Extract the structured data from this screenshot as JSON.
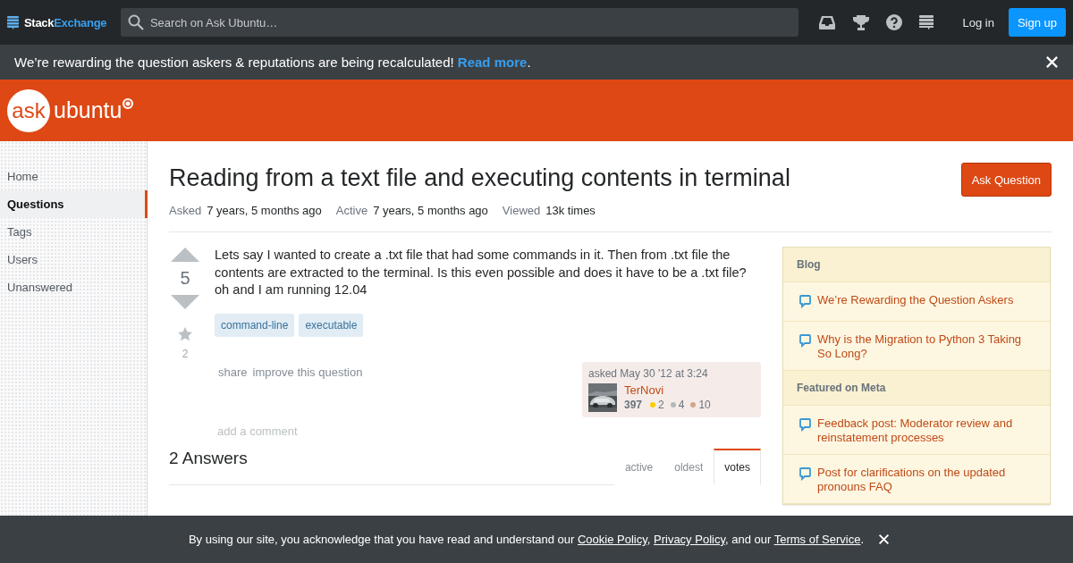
{
  "topbar": {
    "logo": {
      "first": "Stack",
      "second": "Exchange"
    },
    "search": {
      "placeholder": "Search on Ask Ubuntu…"
    },
    "login": "Log in",
    "signup": "Sign up"
  },
  "announcement": {
    "text": "We’re rewarding the question askers & reputations are being recalculated! ",
    "link": "Read more",
    "after": "."
  },
  "site_logo": {
    "bubble": "ask",
    "name": "ubuntu"
  },
  "nav": [
    {
      "label": "Home",
      "selected": false
    },
    {
      "label": "Questions",
      "selected": true
    },
    {
      "label": "Tags",
      "selected": false
    },
    {
      "label": "Users",
      "selected": false
    },
    {
      "label": "Unanswered",
      "selected": false
    }
  ],
  "question": {
    "title": "Reading from a text file and executing contents in terminal",
    "ask_button": "Ask Question",
    "meta": [
      {
        "label": "Asked",
        "value": "7 years, 5 months ago"
      },
      {
        "label": "Active",
        "value": "7 years, 5 months ago"
      },
      {
        "label": "Viewed",
        "value": "13k times"
      }
    ],
    "votes": "5",
    "favorites": "2",
    "body": "Lets say I wanted to create a .txt file that had some commands in it. Then from .txt file the contents are extracted to the terminal. Is this even possible and does it have to be a .txt file? oh and I am running 12.04",
    "tags": [
      "command-line",
      "executable"
    ],
    "actions": [
      "share",
      "improve this question"
    ],
    "owner": {
      "asked": "asked May 30 '12 at 3:24",
      "name": "TerNovi",
      "reputation": "397",
      "badges": [
        {
          "color": "#ffcc01",
          "count": "2"
        },
        {
          "color": "#b4b8bc",
          "count": "4"
        },
        {
          "color": "#d1a684",
          "count": "10"
        }
      ]
    },
    "add_comment": "add a comment"
  },
  "answers": {
    "heading": "2 Answers",
    "tabs": [
      {
        "label": "active",
        "selected": false
      },
      {
        "label": "oldest",
        "selected": false
      },
      {
        "label": "votes",
        "selected": true
      }
    ]
  },
  "sidebar": [
    {
      "heading": "Blog",
      "items": [
        "We’re Rewarding the Question Askers",
        "Why is the Migration to Python 3 Taking So Long?"
      ]
    },
    {
      "heading": "Featured on Meta",
      "items": [
        "Feedback post: Moderator review and reinstatement processes",
        "Post for clarifications on the updated pronouns FAQ"
      ]
    }
  ],
  "cookie_notice": {
    "parts": [
      {
        "kind": "text",
        "text": "By using our site, you acknowledge that you have read and understand our "
      },
      {
        "kind": "link",
        "text": "Cookie Policy"
      },
      {
        "kind": "text",
        "text": ", "
      },
      {
        "kind": "link",
        "text": "Privacy Policy"
      },
      {
        "kind": "text",
        "text": ", and our "
      },
      {
        "kind": "link",
        "text": "Terms of Service"
      },
      {
        "kind": "text",
        "text": "."
      }
    ]
  }
}
